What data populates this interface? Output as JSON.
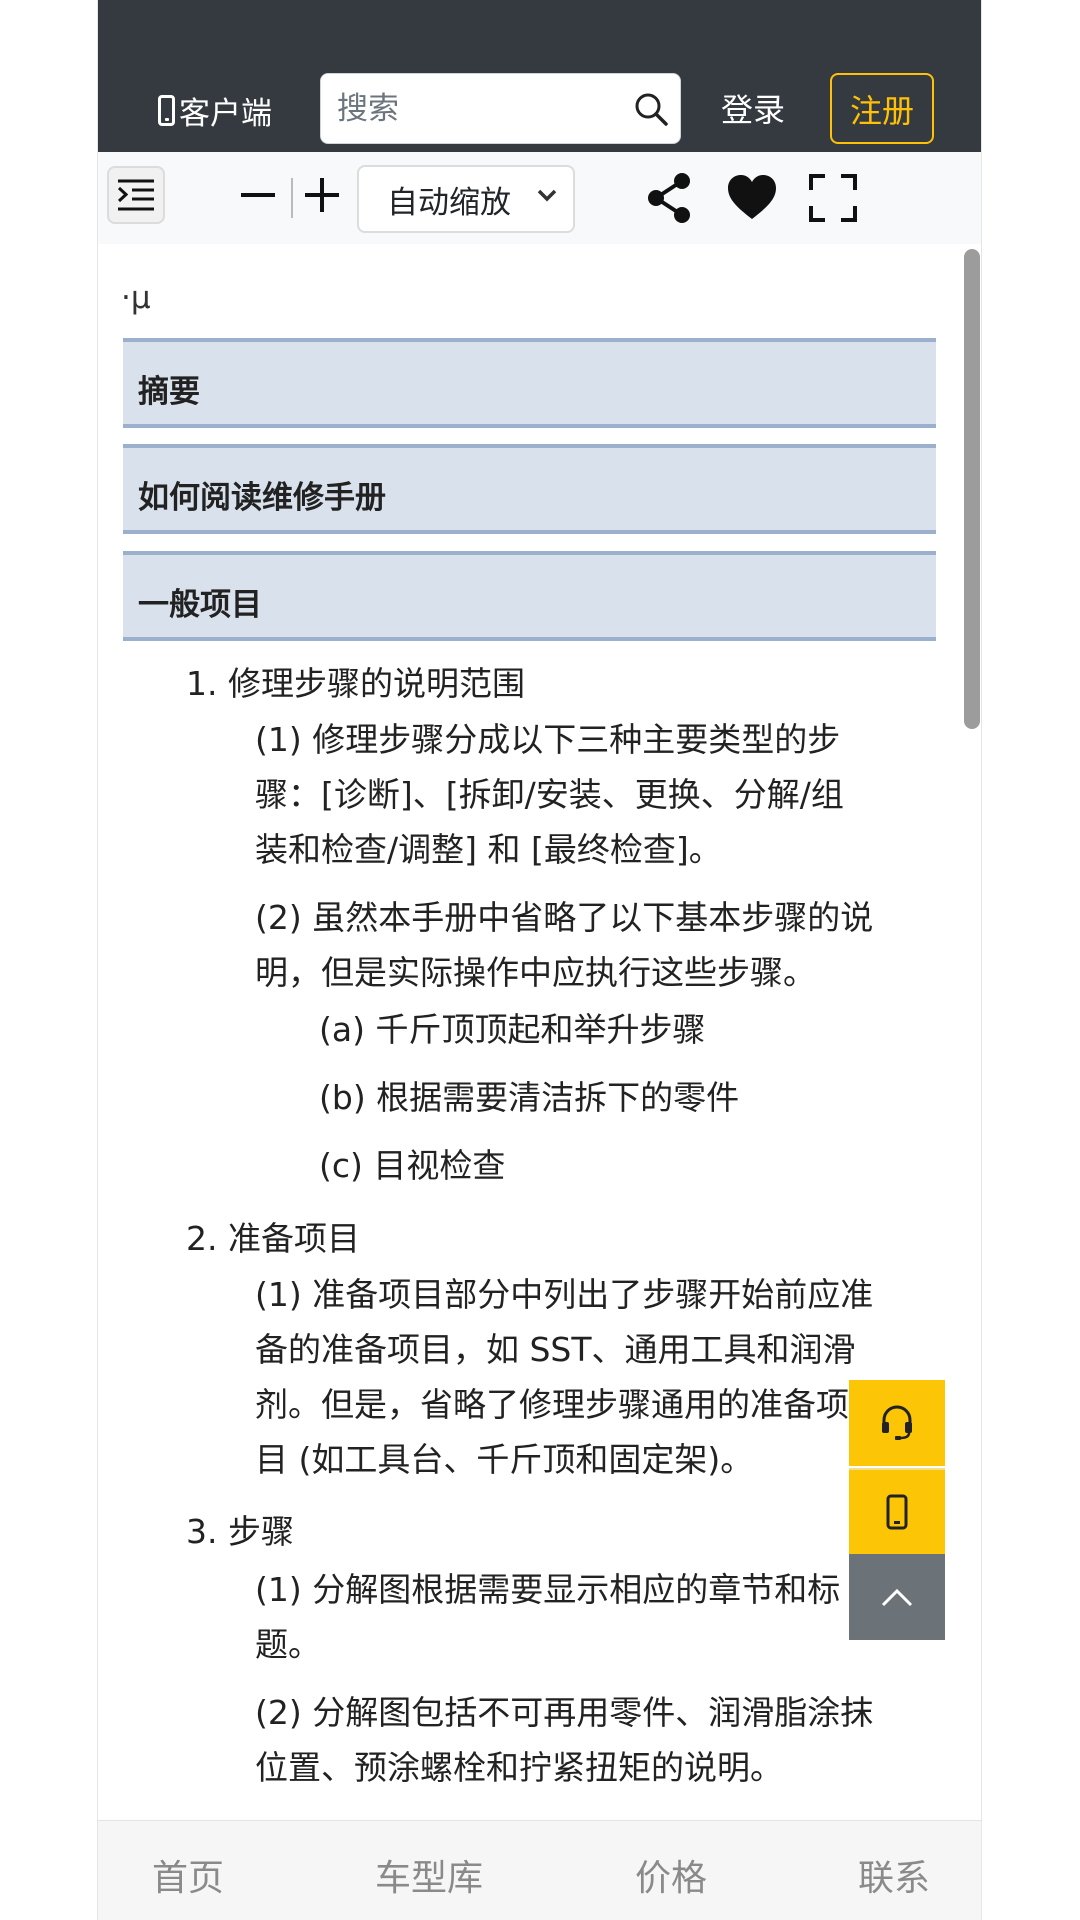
{
  "header": {
    "client_label": "客户端",
    "search_placeholder": "搜索",
    "login_label": "登录",
    "register_label": "注册",
    "accent_color": "#ffc107",
    "background_color": "#343a40"
  },
  "toolbar": {
    "zoom_option": "自动缩放",
    "icons": [
      "outline-icon",
      "minus-icon",
      "plus-icon",
      "share-icon",
      "heart-icon",
      "fullscreen-icon"
    ]
  },
  "document": {
    "mu": "·µ",
    "sections": [
      "摘要",
      "如何阅读维修手册",
      "一般项目"
    ],
    "lines": [
      "1. 修理步骤的说明范围",
      "(1) 修理步骤分成以下三种主要类型的步",
      "骤：[诊断]、[拆卸/安装、更换、分解/组",
      "装和检查/调整] 和 [最终检查]。",
      "(2) 虽然本手册中省略了以下基本步骤的说",
      "明，但是实际操作中应执行这些步骤。",
      "(a) 千斤顶顶起和举升步骤",
      "(b) 根据需要清洁拆下的零件",
      "(c) 目视检查",
      "2. 准备项目",
      "(1) 准备项目部分中列出了步骤开始前应准",
      "备的准备项目，如 SST、通用工具和润滑",
      "剂。但是，省略了修理步骤通用的准备项",
      "目 (如工具台、千斤顶和固定架)。",
      "3. 步骤",
      "(1) 分解图根据需要显示相应的章节和标",
      "题。",
      "(2) 分解图包括不可再用零件、润滑脂涂抹",
      "位置、预涂螺栓和拧紧扭矩的说明。"
    ]
  },
  "floating": {
    "icons": [
      "headset-icon",
      "phone-icon",
      "chevron-up-icon"
    ],
    "color": "#fcc505"
  },
  "bottom_nav": {
    "items": [
      "首页",
      "车型库",
      "价格",
      "联系"
    ]
  }
}
